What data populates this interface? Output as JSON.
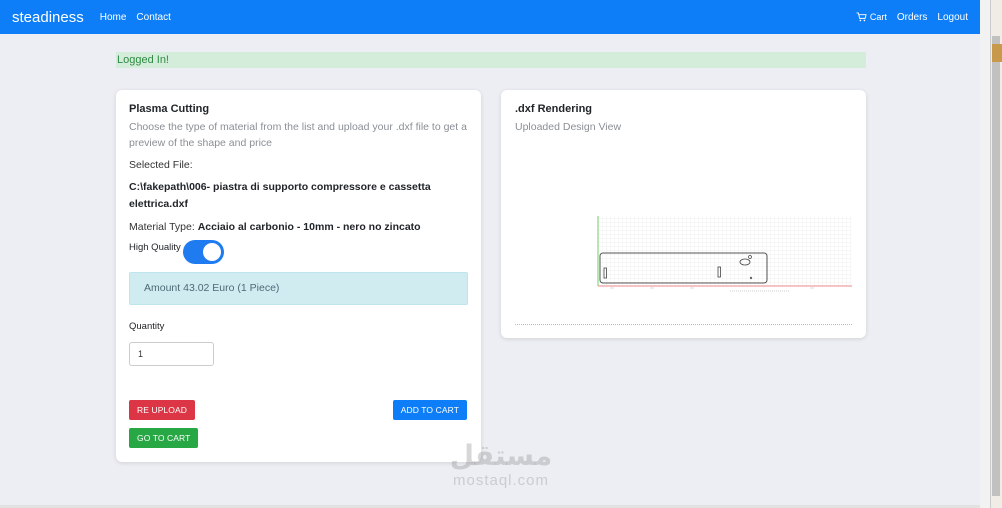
{
  "navbar": {
    "brand": "steadiness",
    "home": "Home",
    "contact": "Contact",
    "cart": "Cart",
    "orders": "Orders",
    "logout": "Logout"
  },
  "alert": {
    "text": "Logged In!"
  },
  "plasma": {
    "title": "Plasma Cutting",
    "description": "Choose the type of material from the list and upload your .dxf file to get a preview of the shape and price",
    "selected_file_label": "Selected File:",
    "selected_file_value": "C:\\fakepath\\006- piastra di supporto compressore e cassetta elettrica.dxf",
    "material_label": "Material Type:",
    "material_value": "Acciaio al carbonio - 10mm - nero no zincato",
    "high_quality_label": "High Quality",
    "high_quality_on": true,
    "amount_text": "Amount 43.02 Euro (1 Piece)",
    "quantity_label": "Quantity",
    "quantity_value": "1",
    "reupload_label": "RE UPLOAD",
    "add_to_cart_label": "ADD TO CART",
    "go_to_cart_label": "GO TO CART"
  },
  "rendering": {
    "title": ".dxf Rendering",
    "subtitle": "Uploaded Design View"
  },
  "watermark": {
    "arabic": "مستقل",
    "latin": "mostaql.com"
  },
  "colors": {
    "primary": "#0d7ef7",
    "danger": "#dc3545",
    "success": "#28a745",
    "alert_bg": "#d4edda",
    "info_bg": "#d1ecf1"
  }
}
